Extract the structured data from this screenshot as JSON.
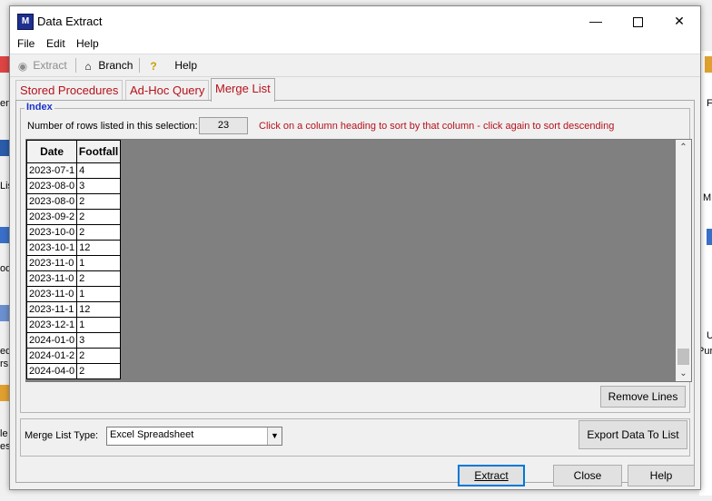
{
  "background": {
    "fragments": [
      "ent",
      "Lis",
      "od",
      "ed",
      "rs",
      "le",
      "es",
      "F",
      "M",
      "U",
      "Pur"
    ]
  },
  "window": {
    "title": "Data Extract",
    "app_icon_text": "M"
  },
  "menu": [
    "File",
    "Edit",
    "Help"
  ],
  "toolbar": {
    "extract": "Extract",
    "branch": "Branch",
    "help": "Help"
  },
  "tabs": [
    {
      "label": "Stored Procedures",
      "active": false
    },
    {
      "label": "Ad-Hoc Query",
      "active": false
    },
    {
      "label": "Merge List",
      "active": true
    }
  ],
  "index": {
    "legend": "Index",
    "rows_label": "Number of rows listed in this selection:",
    "rows_count": "23",
    "hint": "Click on a column heading to sort by that column - click again to sort descending"
  },
  "grid": {
    "headers": [
      "Date",
      "Footfall"
    ],
    "rows": [
      [
        "2023-07-1",
        "4"
      ],
      [
        "2023-08-0",
        "3"
      ],
      [
        "2023-08-0",
        "2"
      ],
      [
        "2023-09-2",
        "2"
      ],
      [
        "2023-10-0",
        "2"
      ],
      [
        "2023-10-1",
        "12"
      ],
      [
        "2023-11-0",
        "1"
      ],
      [
        "2023-11-0",
        "2"
      ],
      [
        "2023-11-0",
        "1"
      ],
      [
        "2023-11-1",
        "12"
      ],
      [
        "2023-12-1",
        "1"
      ],
      [
        "2024-01-0",
        "3"
      ],
      [
        "2024-01-2",
        "2"
      ],
      [
        "2024-04-0",
        "2"
      ]
    ]
  },
  "buttons": {
    "remove_lines": "Remove Lines",
    "export": "Export Data To List",
    "extract": "Extract",
    "close": "Close",
    "help": "Help"
  },
  "merge": {
    "label": "Merge List Type:",
    "value": "Excel Spreadsheet"
  },
  "colors": {
    "tab_text": "#b5121b",
    "legend": "#1a33c8",
    "grid_bg": "#808080"
  }
}
